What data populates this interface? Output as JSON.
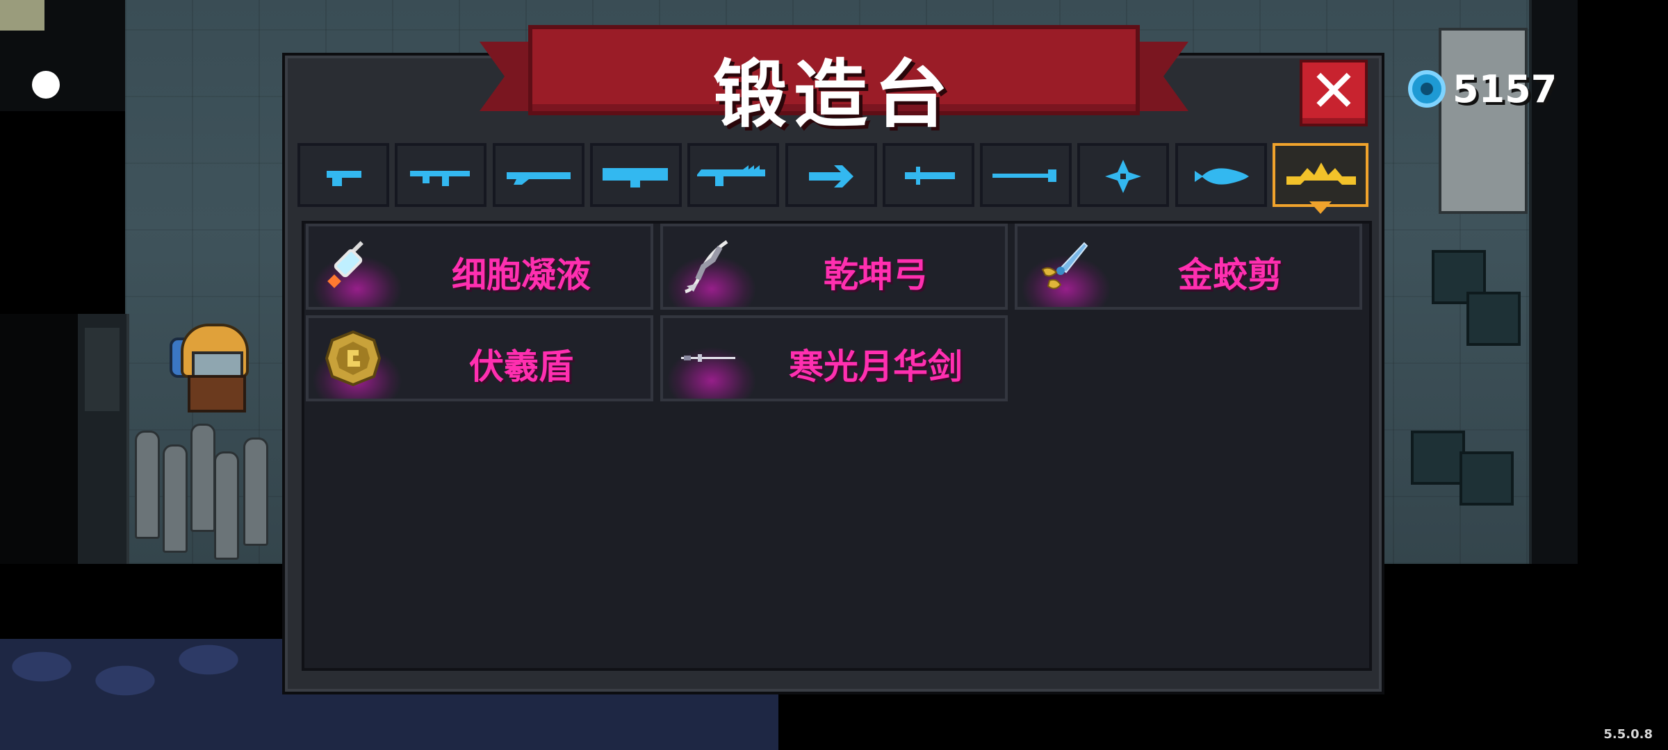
{
  "forge": {
    "title": "锻造台",
    "close_label": "✕"
  },
  "currency": {
    "icon": "gem-icon",
    "amount": "5157",
    "color": "#1e9ad4"
  },
  "categories": [
    {
      "icon": "pistol-icon",
      "active": false
    },
    {
      "icon": "assault-rifle-icon",
      "active": false
    },
    {
      "icon": "shotgun-icon",
      "active": false
    },
    {
      "icon": "launcher-icon",
      "active": false
    },
    {
      "icon": "laser-rifle-icon",
      "active": false
    },
    {
      "icon": "crossbow-icon",
      "active": false
    },
    {
      "icon": "melee-sword-icon",
      "active": false
    },
    {
      "icon": "staff-icon",
      "active": false
    },
    {
      "icon": "throwing-star-icon",
      "active": false
    },
    {
      "icon": "fish-icon",
      "active": false
    },
    {
      "icon": "crown-icon",
      "active": true
    }
  ],
  "items": [
    {
      "name": "细胞凝液",
      "icon": "syringe-icon"
    },
    {
      "name": "乾坤弓",
      "icon": "feather-bow-icon"
    },
    {
      "name": "金蛟剪",
      "icon": "golden-scissors-icon"
    },
    {
      "name": "伏羲盾",
      "icon": "golden-shield-icon"
    },
    {
      "name": "寒光月华剑",
      "icon": "slender-sword-icon"
    }
  ],
  "colors": {
    "tab_icon": "#33b8f0",
    "active_tab": "#f0a32c",
    "item_name": "#ff2fb0",
    "banner": "#9a1c27",
    "close_button": "#c8232f"
  },
  "version": "5.5.0.8"
}
